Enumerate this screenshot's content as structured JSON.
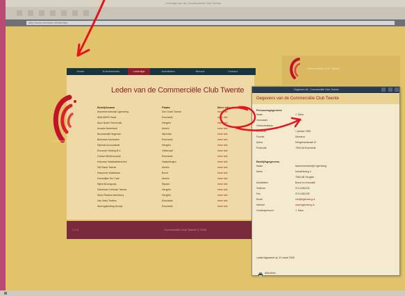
{
  "browser": {
    "title": "Ledenlijst van de Commercieële Club Twente",
    "url": "http://www.cctwente.nl/ledenlijst"
  },
  "site": {
    "nav": [
      {
        "label": "Home"
      },
      {
        "label": "Evenementen"
      },
      {
        "label": "Ledenlijst",
        "active": true
      },
      {
        "label": "Activiteiten"
      },
      {
        "label": "Nieuws"
      },
      {
        "label": "Contact"
      }
    ],
    "logo_text": "Commerciële Club Twente",
    "heading": "Leden van de Commerciële Club Twente",
    "columns": {
      "name": "Bedrijfsnaam",
      "place": "Plaats",
      "link": "Meer info"
    },
    "rows": [
      {
        "name": "Aannemersbedrijf Ligtenberg",
        "place": "Den Oude Twente",
        "link": "meer info"
      },
      {
        "name": "ABN AMRO Bank",
        "place": "Enschede",
        "link": "meer info"
      },
      {
        "name": "Akzo Nobel Chemicals",
        "place": "Hengelo",
        "link": "meer info"
      },
      {
        "name": "Arcadis Nederland",
        "place": "Almelo",
        "link": "meer info"
      },
      {
        "name": "Bouwbedrijf Hegeman",
        "place": "Nijverdal",
        "link": "meer info"
      },
      {
        "name": "Brinkman Advocaten",
        "place": "Enschede",
        "link": "meer info"
      },
      {
        "name": "Dijkhuis Accountants",
        "place": "Hengelo",
        "link": "meer info"
      },
      {
        "name": "Eurocept Holding B.V.",
        "place": "Oldenzaal",
        "link": "meer info"
      },
      {
        "name": "Grolsch Bierbrouwerij",
        "place": "Enschede",
        "link": "meer info"
      },
      {
        "name": "Huisman Installatietechniek",
        "place": "Haaksbergen",
        "link": "meer info"
      },
      {
        "name": "ING Bank Twente",
        "place": "Almelo",
        "link": "meer info"
      },
      {
        "name": "Kampman Makelaars",
        "place": "Borne",
        "link": "meer info"
      },
      {
        "name": "Koninklijke Ten Cate",
        "place": "Almelo",
        "link": "meer info"
      },
      {
        "name": "Nijhof Bouwgroep",
        "place": "Rijssen",
        "link": "meer info"
      },
      {
        "name": "Rabobank Centraal Twente",
        "place": "Hengelo",
        "link": "meer info"
      },
      {
        "name": "Stork Plastics Machinery",
        "place": "Hengelo",
        "link": "meer info"
      },
      {
        "name": "Van Heek Textiles",
        "place": "Enschede",
        "link": "meer info"
      },
      {
        "name": "Woningstichting Domijn",
        "place": "Enschede",
        "link": "meer info"
      }
    ],
    "footer_pages": "1 2 3",
    "footer_copy": "Commerciële Club Twente © 2006"
  },
  "popup": {
    "window_title": "Gegevens lid - Commerciële Club Twente",
    "heading": "Gegevens van de Commerciële Club Twente",
    "section1": "Persoonsgegevens",
    "fields1": [
      {
        "k": "Naam",
        "v": "J. Gans"
      },
      {
        "k": "Voornaam",
        "v": "Johan"
      },
      {
        "k": "Geboortedatum",
        "v": ""
      },
      {
        "k": "Lid sinds",
        "v": "1 januari 1996"
      },
      {
        "k": "Functie",
        "v": "Directeur"
      },
      {
        "k": "Adres",
        "v": "Hengelosestraat 12"
      },
      {
        "k": "Postcode",
        "v": "7500 AA Enschede"
      }
    ],
    "section2": "Bedrijfsgegevens",
    "fields2": [
      {
        "k": "Naam",
        "v": "Aannemersbedrijf Ligtenberg"
      },
      {
        "k": "Adres",
        "v": "Industrieweg 4"
      },
      {
        "k": "",
        "v": "7550 AB Hengelo"
      },
      {
        "k": "Activiteiten",
        "v": "Bouw en renovatie"
      },
      {
        "k": "Telefoon",
        "v": "074-2451234"
      },
      {
        "k": "Fax",
        "v": "074-2451235"
      },
      {
        "k": "Email",
        "v": "info@ligtenberg.nl",
        "link": true
      },
      {
        "k": "Internet",
        "v": "www.ligtenberg.nl",
        "link": true
      },
      {
        "k": "Contactpersoon",
        "v": "J. Gans"
      }
    ],
    "note": "Laatst bijgewerkt op 12 maart 2006",
    "print_label": "Afdrukken"
  }
}
